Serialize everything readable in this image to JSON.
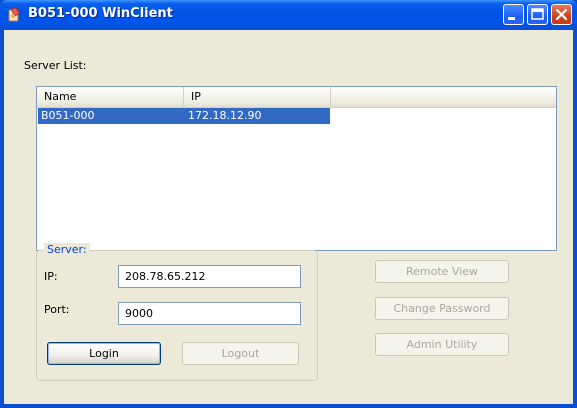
{
  "window": {
    "title": "B051-000 WinClient",
    "title_buttons": [
      "minimize-icon",
      "maximize-icon",
      "close-icon"
    ]
  },
  "server_list": {
    "label": "Server List:",
    "columns": [
      "Name",
      "IP"
    ],
    "rows": [
      {
        "name": "B051-000",
        "ip": "172.18.12.90",
        "selected": true
      }
    ]
  },
  "server_group": {
    "title": "Server:",
    "ip_label": "IP:",
    "ip_value": "208.78.65.212",
    "port_label": "Port:",
    "port_value": "9000",
    "login_label": "Login",
    "logout_label": "Logout"
  },
  "actions": {
    "remote_view_label": "Remote View",
    "change_password_label": "Change Password",
    "admin_utility_label": "Admin Utility"
  },
  "colors": {
    "titlebar": "#0054e3",
    "selection": "#316ac5",
    "group_title": "#0046d5",
    "disabled_text": "#aca899"
  }
}
